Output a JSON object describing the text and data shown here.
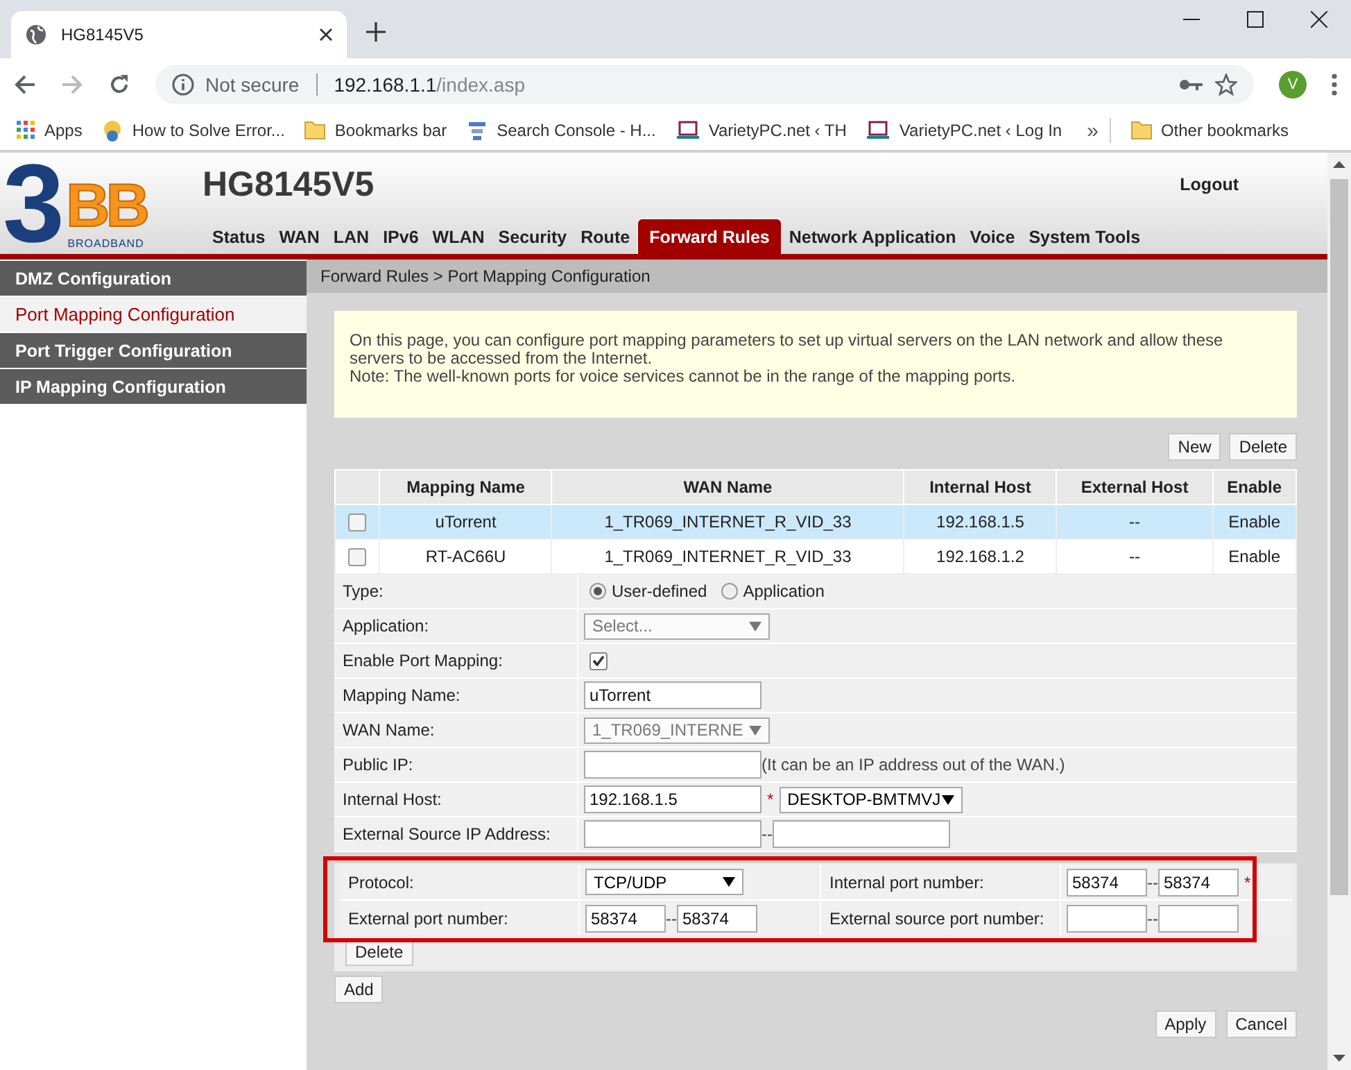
{
  "browser": {
    "tab": {
      "title": "HG8145V5"
    },
    "security": "Not secure",
    "url_host": "192.168.1.1",
    "url_path": "/index.asp",
    "profile_initial": "V",
    "bookmarks": [
      {
        "label": "Apps",
        "kind": "apps"
      },
      {
        "label": "How to Solve Error...",
        "kind": "page"
      },
      {
        "label": "Bookmarks bar",
        "kind": "folder"
      },
      {
        "label": "Search Console - H...",
        "kind": "search"
      },
      {
        "label": "VarietyPC.net ‹ TH",
        "kind": "site"
      },
      {
        "label": "VarietyPC.net ‹ Log In",
        "kind": "site"
      }
    ],
    "overflow": "»",
    "other_bookmarks": {
      "label": "Other bookmarks",
      "kind": "folder"
    }
  },
  "header": {
    "logo": {
      "numeral": "3",
      "letters": "BB",
      "tagline": "BROADBAND"
    },
    "title": "HG8145V5",
    "logout": "Logout",
    "nav": [
      {
        "label": "Status",
        "selected": false
      },
      {
        "label": "WAN",
        "selected": false
      },
      {
        "label": "LAN",
        "selected": false
      },
      {
        "label": "IPv6",
        "selected": false
      },
      {
        "label": "WLAN",
        "selected": false
      },
      {
        "label": "Security",
        "selected": false
      },
      {
        "label": "Route",
        "selected": false
      },
      {
        "label": "Forward Rules",
        "selected": true
      },
      {
        "label": "Network Application",
        "selected": false
      },
      {
        "label": "Voice",
        "selected": false
      },
      {
        "label": "System Tools",
        "selected": false
      }
    ]
  },
  "sidebar": {
    "items": [
      {
        "label": "DMZ Configuration",
        "selected": false
      },
      {
        "label": "Port Mapping Configuration",
        "selected": true
      },
      {
        "label": "Port Trigger Configuration",
        "selected": false
      },
      {
        "label": "IP Mapping Configuration",
        "selected": false
      }
    ]
  },
  "breadcrumb": "Forward Rules > Port Mapping Configuration",
  "notice": [
    "On this page, you can configure port mapping parameters to set up virtual servers on the LAN network and allow these servers to be accessed from the Internet.",
    "Note: The well-known ports for voice services cannot be in the range of the mapping ports."
  ],
  "table_buttons": [
    "New",
    "Delete"
  ],
  "table": {
    "columns": [
      "Mapping Name",
      "WAN Name",
      "Internal Host",
      "External Host",
      "Enable"
    ],
    "rows": [
      {
        "checked": false,
        "selected": true,
        "cells": [
          "uTorrent",
          "1_TR069_INTERNET_R_VID_33",
          "192.168.1.5",
          "--",
          "Enable"
        ]
      },
      {
        "checked": false,
        "selected": false,
        "cells": [
          "RT-AC66U",
          "1_TR069_INTERNET_R_VID_33",
          "192.168.1.2",
          "--",
          "Enable"
        ]
      }
    ]
  },
  "form": [
    {
      "label": "Type:",
      "kind": "radio",
      "options": [
        {
          "label": "User-defined",
          "selected": true
        },
        {
          "label": "Application",
          "selected": false
        }
      ]
    },
    {
      "label": "Application:",
      "kind": "select",
      "value": "Select...",
      "disabled": true
    },
    {
      "label": "Enable Port Mapping:",
      "kind": "checkbox",
      "checked": true
    },
    {
      "label": "Mapping Name:",
      "kind": "text",
      "value": "uTorrent"
    },
    {
      "label": "WAN Name:",
      "kind": "select",
      "value": "1_TR069_INTERNE",
      "disabled": true
    },
    {
      "label": "Public IP:",
      "kind": "text",
      "note": "(It can be an IP address out of the WAN.)"
    },
    {
      "label": "Internal Host:",
      "kind": "host",
      "value": "192.168.1.5",
      "required_mark": "*",
      "device": "DESKTOP-BMTMVJ"
    },
    {
      "label": "External Source IP Address:",
      "kind": "range",
      "separator": "--"
    }
  ],
  "protocol": {
    "highlighted": true,
    "fields": [
      {
        "label": "Protocol:",
        "kind": "select",
        "value": "TCP/UDP",
        "disabled": false
      },
      {
        "label": "Internal port number:",
        "kind": "range",
        "from": "58374",
        "to": "58374",
        "separator": "--",
        "required_mark": "*"
      },
      {
        "label": "External port number:",
        "kind": "range",
        "from": "58374",
        "to": "58374",
        "separator": "--"
      },
      {
        "label": "External source port number:",
        "kind": "range",
        "separator": "--"
      }
    ],
    "delete_button": "Delete"
  },
  "add_button": "Add",
  "footer_buttons": [
    "Apply",
    "Cancel"
  ]
}
